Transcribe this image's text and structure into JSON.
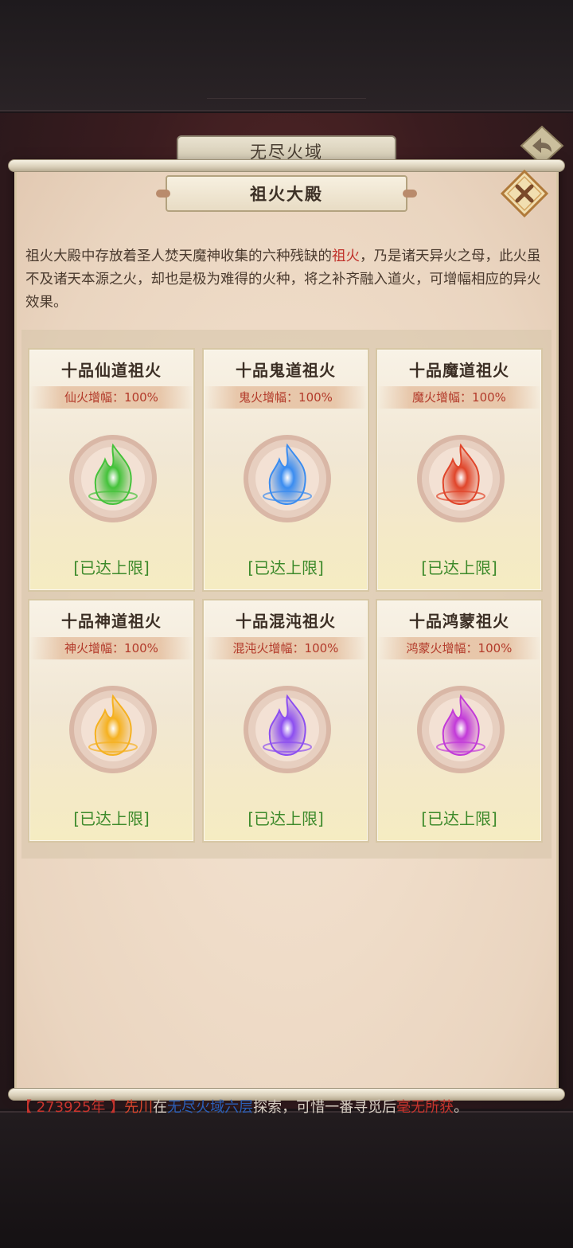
{
  "header": {
    "title": "无尽火域"
  },
  "panel": {
    "title": "祖火大殿",
    "description": {
      "part1": "祖火大殿中存放着圣人焚天魔神收集的六种残缺的",
      "highlight": "祖火",
      "part2": "，乃是诸天异火之母，此火虽不及诸天本源之火，却也是极为难得的火种，将之补齐融入道火，可增幅相应的异火效果。"
    }
  },
  "cards": [
    {
      "title": "十品仙道祖火",
      "bonus": "仙火增幅：100%",
      "status": "[已达上限]",
      "color": "#44c23a",
      "icon": "green-fire-icon"
    },
    {
      "title": "十品鬼道祖火",
      "bonus": "鬼火增幅：100%",
      "status": "[已达上限]",
      "color": "#3a8cf0",
      "icon": "blue-fire-icon"
    },
    {
      "title": "十品魔道祖火",
      "bonus": "魔火增幅：100%",
      "status": "[已达上限]",
      "color": "#e0452a",
      "icon": "red-fire-icon"
    },
    {
      "title": "十品神道祖火",
      "bonus": "神火增幅：100%",
      "status": "[已达上限]",
      "color": "#f5b120",
      "icon": "gold-fire-icon"
    },
    {
      "title": "十品混沌祖火",
      "bonus": "混沌火增幅：100%",
      "status": "[已达上限]",
      "color": "#8c4ef0",
      "icon": "purple-fire-icon"
    },
    {
      "title": "十品鸿蒙祖火",
      "bonus": "鸿蒙火增幅：100%",
      "status": "[已达上限]",
      "color": "#c23ad8",
      "icon": "magenta-fire-icon"
    }
  ],
  "log": {
    "year": "【 273925年 】",
    "player": "先川",
    "text1": "在",
    "location": "无尽火域六层",
    "text2": "探索，可惜一番寻觅后",
    "result": "毫无所获",
    "end": "。"
  }
}
